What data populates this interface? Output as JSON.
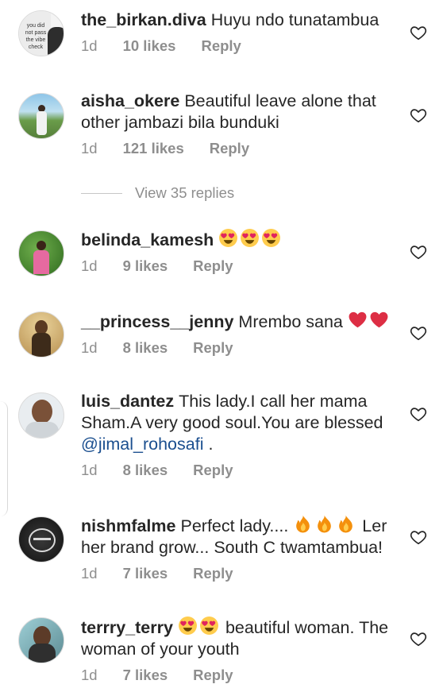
{
  "comments": [
    {
      "username": "the_birkan.diva",
      "text": "Huyu ndo tunatambua",
      "time": "1d",
      "likes": "10 likes",
      "reply": "Reply",
      "avatar_text": "you did not pass the vibe check"
    },
    {
      "username": "aisha_okere",
      "text": "Beautiful leave alone that other jambazi bila bunduki",
      "time": "1d",
      "likes": "121 likes",
      "reply": "Reply"
    },
    {
      "username": "belinda_kamesh",
      "text": "",
      "emojis": [
        "heart-eyes",
        "heart-eyes",
        "heart-eyes"
      ],
      "time": "1d",
      "likes": "9 likes",
      "reply": "Reply"
    },
    {
      "username": "__princess__jenny",
      "text": "Mrembo sana",
      "emojis": [
        "red-heart",
        "red-heart"
      ],
      "time": "1d",
      "likes": "8 likes",
      "reply": "Reply"
    },
    {
      "username": "luis_dantez",
      "text": "This lady.I call her mama Sham.A very good soul.You are blessed",
      "mention": "@jimal_rohosafi",
      "text_after": " .",
      "time": "1d",
      "likes": "8 likes",
      "reply": "Reply"
    },
    {
      "username": "nishmfalme",
      "text_before": "Perfect lady....",
      "emojis": [
        "fire",
        "fire",
        "fire"
      ],
      "text": "Ler her brand grow... South C twamtambua!",
      "time": "1d",
      "likes": "7 likes",
      "reply": "Reply"
    },
    {
      "username": "terrry_terry",
      "emojis": [
        "heart-eyes",
        "heart-eyes"
      ],
      "text": "beautiful woman. The woman of your youth",
      "time": "1d",
      "likes": "7 likes",
      "reply": "Reply"
    }
  ],
  "view_replies": "View 35 replies",
  "colors": {
    "text": "#262626",
    "muted": "#8e8e8e",
    "mention": "#1b4f8f",
    "heart_emoji": "#e0245e",
    "divider": "#c7c7c7"
  }
}
